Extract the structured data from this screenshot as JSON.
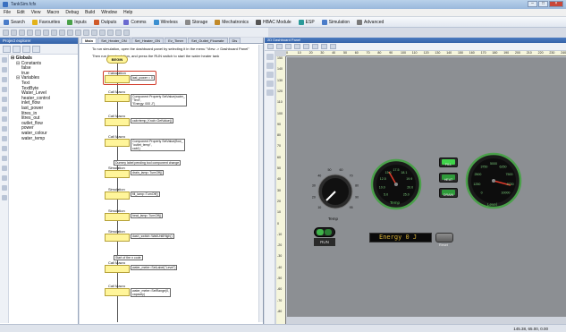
{
  "window": {
    "title": "TankSim.fcfx"
  },
  "menu": [
    "File",
    "Edit",
    "View",
    "Macro",
    "Debug",
    "Build",
    "Window",
    "Help"
  ],
  "ribbon": [
    {
      "label": "Search",
      "icon": "search-icon",
      "color": "#4a7cc9"
    },
    {
      "label": "Favourites",
      "icon": "star-icon",
      "color": "#e3b21a"
    },
    {
      "label": "Inputs",
      "icon": "inputs-icon",
      "color": "#4aa14a"
    },
    {
      "label": "Outputs",
      "icon": "outputs-icon",
      "color": "#d05a2a"
    },
    {
      "label": "Comms",
      "icon": "comms-icon",
      "color": "#6a6ad0"
    },
    {
      "label": "Wireless",
      "icon": "wireless-icon",
      "color": "#3b8fd0"
    },
    {
      "label": "Storage",
      "icon": "storage-icon",
      "color": "#8a8a8a"
    },
    {
      "label": "Mechatronics",
      "icon": "mechatronics-icon",
      "color": "#c28a2a"
    },
    {
      "label": "HBAC Module",
      "icon": "module-icon",
      "color": "#555555"
    },
    {
      "label": "ESP",
      "icon": "esp-icon",
      "color": "#2a9a9a"
    },
    {
      "label": "Simulation",
      "icon": "simulation-icon",
      "color": "#4a7cc9"
    },
    {
      "label": "Advanced",
      "icon": "advanced-icon",
      "color": "#7a7a7a"
    }
  ],
  "project": {
    "title": "Project explorer",
    "tree": [
      {
        "label": "Globals",
        "bold": true,
        "indent": 0
      },
      {
        "label": "Constants",
        "indent": 1
      },
      {
        "label": "false",
        "indent": 2
      },
      {
        "label": "true",
        "indent": 2
      },
      {
        "label": "Variables",
        "indent": 1
      },
      {
        "label": "Text",
        "indent": 2
      },
      {
        "label": "TextByte",
        "indent": 2
      },
      {
        "label": "Water_Level",
        "indent": 2
      },
      {
        "label": "heater_control",
        "indent": 2
      },
      {
        "label": "inlet_flow",
        "indent": 2
      },
      {
        "label": "last_power",
        "indent": 2
      },
      {
        "label": "litres_in",
        "indent": 2
      },
      {
        "label": "litres_out",
        "indent": 2
      },
      {
        "label": "outlet_flow",
        "indent": 2
      },
      {
        "label": "power",
        "indent": 2
      },
      {
        "label": "water_colour",
        "indent": 2
      },
      {
        "label": "water_temp",
        "indent": 2
      }
    ]
  },
  "doc": {
    "tabs": [
      "Main",
      "Set_Heater_ON",
      "Set_Heater_ON",
      "Ev_Timer",
      "Set_Outlet_Flowrate",
      "Dis"
    ],
    "instructions": [
      "To run simulation, open the dashboard panel by selecting it in the menu \"View -> Dashboard Panel\"",
      "Then run the simulation, and press the RUN switch to start the water heater tank"
    ],
    "begin": "BEGIN",
    "blocks": [
      {
        "label": "Calculation",
        "note": "last_power = 0"
      },
      {
        "label": "Call Macro",
        "note": "Component Property SetValue(water_\n\"Text\",\n\"Energy: 000 J\")"
      },
      {
        "label": "Call Macro",
        "note": "cab>temp_Knob::GetValue()"
      },
      {
        "label": "Call Macro",
        "note": "Component Property SetValue(flow_\n\"outlet_temp\",\ncab1)"
      },
      {
        "label": "",
        "note": "Dummy label pending tool component change"
      },
      {
        "label": "Simulation",
        "note": "drain_lamp::TurnOff()"
      },
      {
        "label": "Simulation",
        "note": "fill_lamp::TurnOff()"
      },
      {
        "label": "Simulation",
        "note": "heat_lamp::TurnOff()"
      },
      {
        "label": "Simulation",
        "note": "dash_switch::WaitUntilHigh()"
      },
      {
        "label": "",
        "note": "Start of the n code"
      },
      {
        "label": "Call Macro",
        "note": "water_meter::SetLabel(\"Level\")"
      },
      {
        "label": "Call Macro",
        "note": "water_meter::SetRange(0,\ncapacity)"
      }
    ]
  },
  "dashboard": {
    "title": "2D Dashboard Panel",
    "ruler_x": [
      "0",
      "10",
      "20",
      "30",
      "40",
      "50",
      "60",
      "70",
      "80",
      "90",
      "100",
      "110",
      "120",
      "130",
      "140",
      "150",
      "160",
      "170",
      "180",
      "190",
      "200",
      "210",
      "220",
      "230",
      "240"
    ],
    "ruler_y": [
      "150",
      "140",
      "130",
      "120",
      "110",
      "100",
      "90",
      "80",
      "70",
      "60",
      "50",
      "40",
      "30",
      "20",
      "10",
      "0",
      "-10",
      "-20",
      "-30",
      "-40",
      "-50",
      "-60",
      "-70",
      "-80"
    ],
    "knob": {
      "label": "Temp",
      "ticks": [
        "10",
        "20",
        "30",
        "40",
        "50",
        "60",
        "70",
        "80",
        "90",
        "95"
      ]
    },
    "temp_gauge": {
      "label": "Temp",
      "ticks": [
        "5.0",
        "10.0",
        "12.5",
        "15.0",
        "17.5",
        "18.1",
        "19.9",
        "20.0",
        "25.0"
      ],
      "value": "15.0"
    },
    "buttons": [
      {
        "label": "FILL",
        "color": "#3fd34a"
      },
      {
        "label": "HEAT",
        "color": "#2e9a3a"
      },
      {
        "label": "DRAIN",
        "color": "#2e9a3a"
      }
    ],
    "level_gauge": {
      "label": "Level",
      "ticks": [
        "0",
        "1250",
        "2500",
        "3750",
        "5000",
        "6250",
        "7500",
        "8750",
        "10000"
      ]
    },
    "run_switch_label": "RUN",
    "energy_display": "Energy 0 J",
    "reset_label": "Reset",
    "status_coords": "145.38, 65.00, 0.00"
  }
}
